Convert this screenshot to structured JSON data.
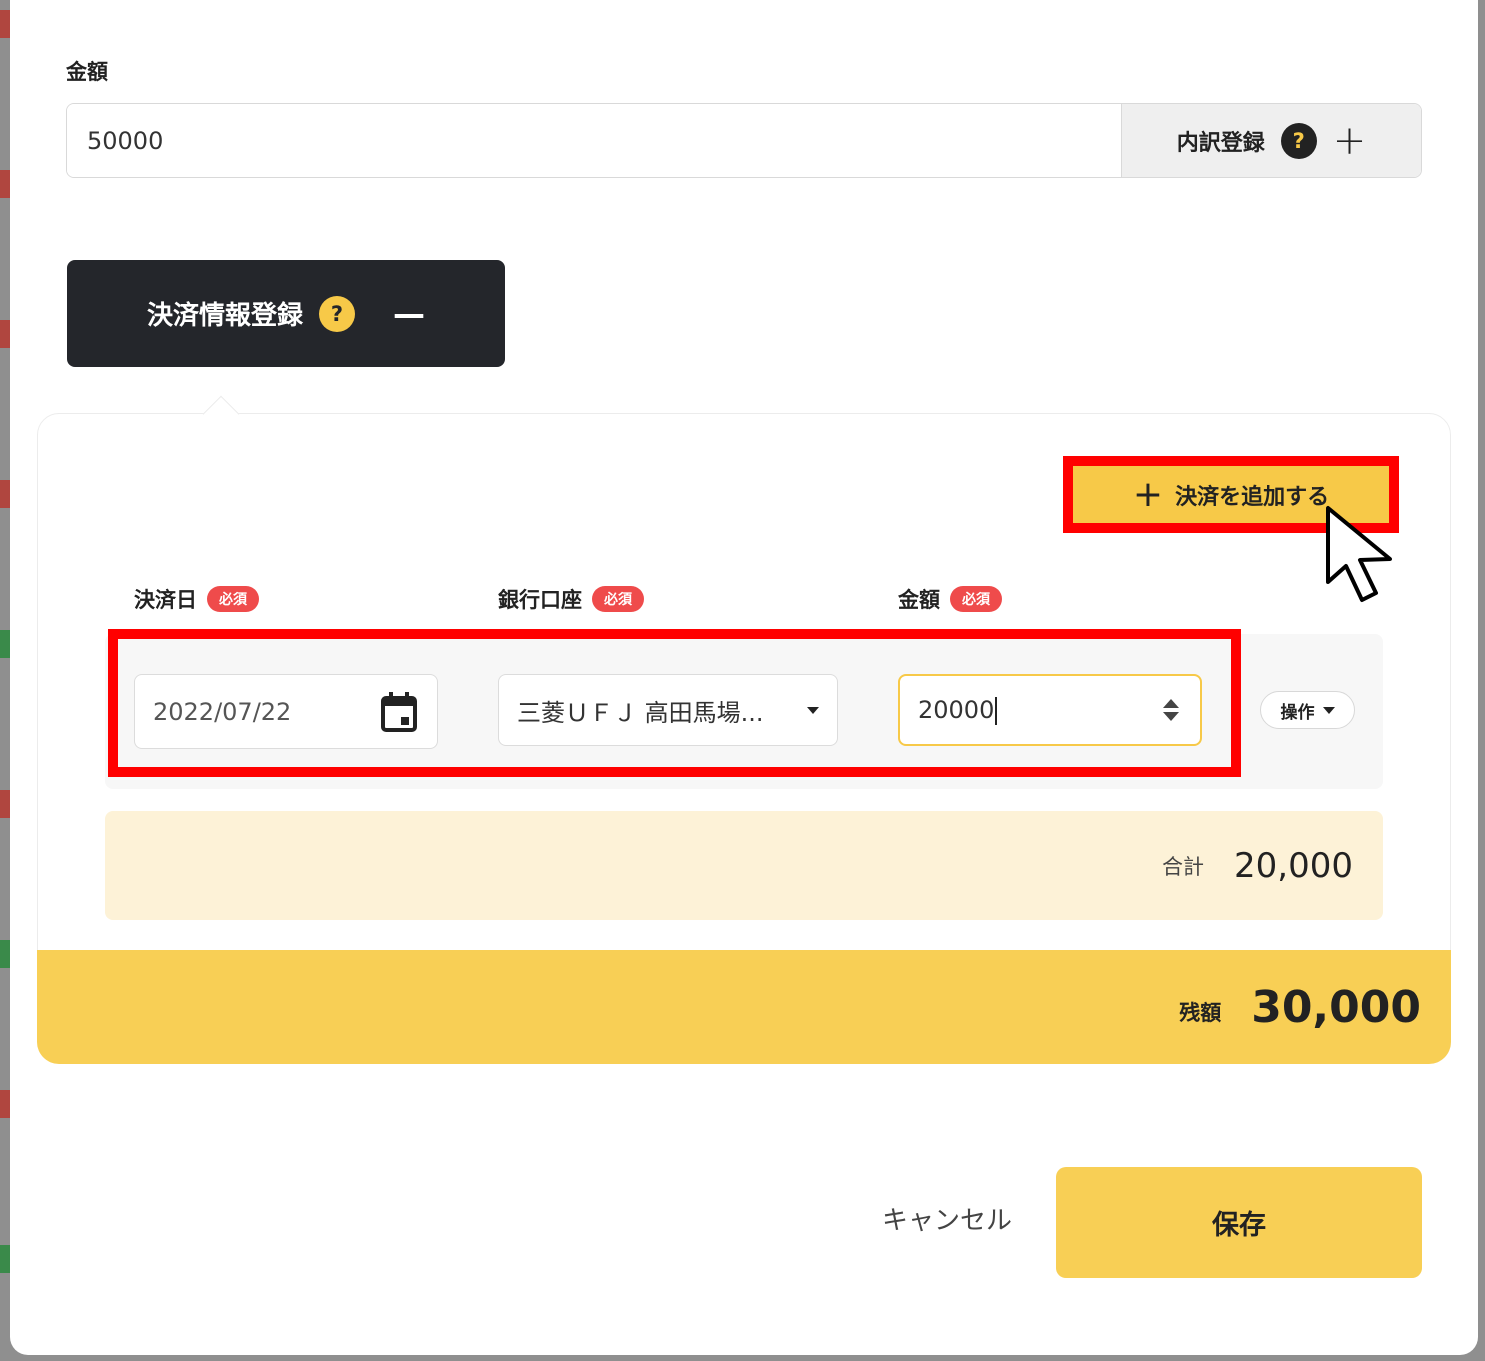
{
  "amount_section": {
    "label": "金額",
    "value": "50000",
    "breakdown_button_label": "内訳登録",
    "help_glyph": "?",
    "add_glyph": "+"
  },
  "payment_toggle": {
    "label": "決済情報登録",
    "help_glyph": "?",
    "collapse_glyph": "—"
  },
  "payment_panel": {
    "add_button_label": "決済を追加する",
    "add_glyph": "+",
    "columns": [
      {
        "label": "決済日",
        "badge": "必須"
      },
      {
        "label": "銀行口座",
        "badge": "必須"
      },
      {
        "label": "金額",
        "badge": "必須"
      }
    ],
    "row": {
      "date": "2022/07/22",
      "bank": "三菱ＵＦＪ 高田馬場...",
      "amount": "20000",
      "operation_label": "操作"
    },
    "total": {
      "label": "合計",
      "value": "20,000"
    },
    "balance": {
      "label": "残額",
      "value": "30,000"
    }
  },
  "footer": {
    "cancel_label": "キャンセル",
    "save_label": "保存"
  },
  "icons": {
    "calendar": "calendar-icon",
    "dropdown": "chevron-down-icon",
    "stepper": "number-stepper-icon",
    "cursor": "mouse-pointer-icon"
  },
  "colors": {
    "accent_yellow": "#f8cf55",
    "highlight_red": "#ff0000",
    "dark": "#24262b",
    "required_badge": "#ef4b4b"
  }
}
